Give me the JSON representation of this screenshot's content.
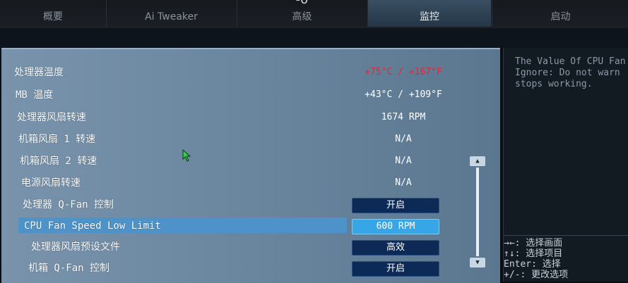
{
  "tabs": [
    {
      "label": "概要"
    },
    {
      "label": "Ai Tweaker"
    },
    {
      "label": "高级",
      "icon": "-0"
    },
    {
      "label": "监控",
      "active": true
    },
    {
      "label": "启动"
    }
  ],
  "settings": [
    {
      "label": "处理器温度",
      "value": "+75°C / +167°F",
      "hot": true
    },
    {
      "label": "MB 温度",
      "value": "+43°C / +109°F"
    },
    {
      "label": "处理器风扇转速",
      "value": "1674 RPM"
    },
    {
      "label": "机箱风扇 1 转速",
      "value": "N/A"
    },
    {
      "label": "机箱风扇 2 转速",
      "value": "N/A"
    },
    {
      "label": "电源风扇转速",
      "value": "N/A"
    },
    {
      "label": "处理器 Q-Fan 控制",
      "button": "开启"
    },
    {
      "label": "CPU Fan Speed Low Limit",
      "button": "600 RPM",
      "selected": true
    },
    {
      "label": "处理器风扇预设文件",
      "button": "高效"
    },
    {
      "label": "机箱 Q-Fan 控制",
      "button": "开启"
    }
  ],
  "help": {
    "text": "The Value Of CPU Fan\nIgnore: Do not warn\nstops working.",
    "keys": "→←: 选择画面\n↑↓: 选择项目\nEnter: 选择\n+/-: 更改选项"
  },
  "colors": {
    "panel": "#7090a8",
    "selected_row": "#4d93c9",
    "button": "#0c2a55",
    "hot_value": "#e0263a"
  }
}
